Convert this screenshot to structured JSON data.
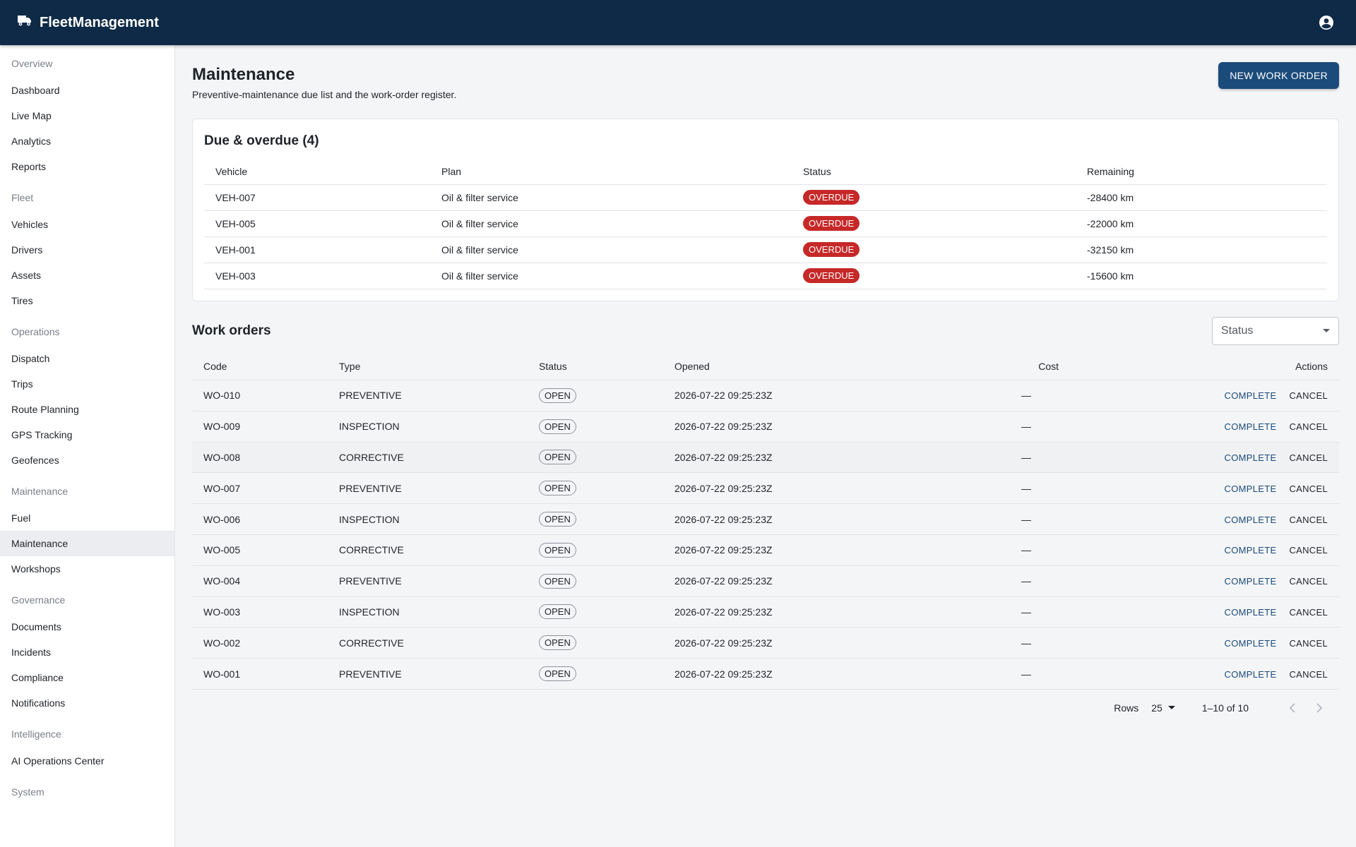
{
  "app": {
    "title": "FleetManagement"
  },
  "sidebar": {
    "groups": [
      {
        "title": "Overview",
        "items": [
          "Dashboard",
          "Live Map",
          "Analytics",
          "Reports"
        ]
      },
      {
        "title": "Fleet",
        "items": [
          "Vehicles",
          "Drivers",
          "Assets",
          "Tires"
        ]
      },
      {
        "title": "Operations",
        "items": [
          "Dispatch",
          "Trips",
          "Route Planning",
          "GPS Tracking",
          "Geofences"
        ]
      },
      {
        "title": "Maintenance",
        "items": [
          "Fuel",
          "Maintenance",
          "Workshops"
        ]
      },
      {
        "title": "Governance",
        "items": [
          "Documents",
          "Incidents",
          "Compliance",
          "Notifications"
        ]
      },
      {
        "title": "Intelligence",
        "items": [
          "AI Operations Center"
        ]
      },
      {
        "title": "System",
        "items": []
      }
    ],
    "active_item": "Maintenance"
  },
  "page": {
    "title": "Maintenance",
    "subtitle": "Preventive-maintenance due list and the work-order register.",
    "new_button": "NEW WORK ORDER"
  },
  "due": {
    "title": "Due & overdue (4)",
    "columns": [
      "Vehicle",
      "Plan",
      "Status",
      "Remaining"
    ],
    "rows": [
      {
        "vehicle": "VEH-007",
        "plan": "Oil & filter service",
        "status": "OVERDUE",
        "remaining": "-28400 km"
      },
      {
        "vehicle": "VEH-005",
        "plan": "Oil & filter service",
        "status": "OVERDUE",
        "remaining": "-22000 km"
      },
      {
        "vehicle": "VEH-001",
        "plan": "Oil & filter service",
        "status": "OVERDUE",
        "remaining": "-32150 km"
      },
      {
        "vehicle": "VEH-003",
        "plan": "Oil & filter service",
        "status": "OVERDUE",
        "remaining": "-15600 km"
      }
    ]
  },
  "work_orders": {
    "title": "Work orders",
    "status_filter_placeholder": "Status",
    "columns": [
      "Code",
      "Type",
      "Status",
      "Opened",
      "Cost",
      "Actions"
    ],
    "complete_label": "COMPLETE",
    "cancel_label": "CANCEL",
    "rows": [
      {
        "code": "WO-010",
        "type": "PREVENTIVE",
        "status": "OPEN",
        "opened": "2026-07-22 09:25:23Z",
        "cost": "—"
      },
      {
        "code": "WO-009",
        "type": "INSPECTION",
        "status": "OPEN",
        "opened": "2026-07-22 09:25:23Z",
        "cost": "—"
      },
      {
        "code": "WO-008",
        "type": "CORRECTIVE",
        "status": "OPEN",
        "opened": "2026-07-22 09:25:23Z",
        "cost": "—"
      },
      {
        "code": "WO-007",
        "type": "PREVENTIVE",
        "status": "OPEN",
        "opened": "2026-07-22 09:25:23Z",
        "cost": "—"
      },
      {
        "code": "WO-006",
        "type": "INSPECTION",
        "status": "OPEN",
        "opened": "2026-07-22 09:25:23Z",
        "cost": "—"
      },
      {
        "code": "WO-005",
        "type": "CORRECTIVE",
        "status": "OPEN",
        "opened": "2026-07-22 09:25:23Z",
        "cost": "—"
      },
      {
        "code": "WO-004",
        "type": "PREVENTIVE",
        "status": "OPEN",
        "opened": "2026-07-22 09:25:23Z",
        "cost": "—"
      },
      {
        "code": "WO-003",
        "type": "INSPECTION",
        "status": "OPEN",
        "opened": "2026-07-22 09:25:23Z",
        "cost": "—"
      },
      {
        "code": "WO-002",
        "type": "CORRECTIVE",
        "status": "OPEN",
        "opened": "2026-07-22 09:25:23Z",
        "cost": "—"
      },
      {
        "code": "WO-001",
        "type": "PREVENTIVE",
        "status": "OPEN",
        "opened": "2026-07-22 09:25:23Z",
        "cost": "—"
      }
    ],
    "hovered_row": "WO-008",
    "pagination": {
      "rows_label": "Rows",
      "rows_per_page": "25",
      "range": "1–10 of 10"
    }
  },
  "colors": {
    "topbar": "#0e2a47",
    "primary": "#1b4b7a",
    "overdue": "#c62828"
  },
  "icons": {
    "brand": "truck-icon",
    "account": "account-circle-icon",
    "prev": "chevron-left-icon",
    "next": "chevron-right-icon"
  }
}
